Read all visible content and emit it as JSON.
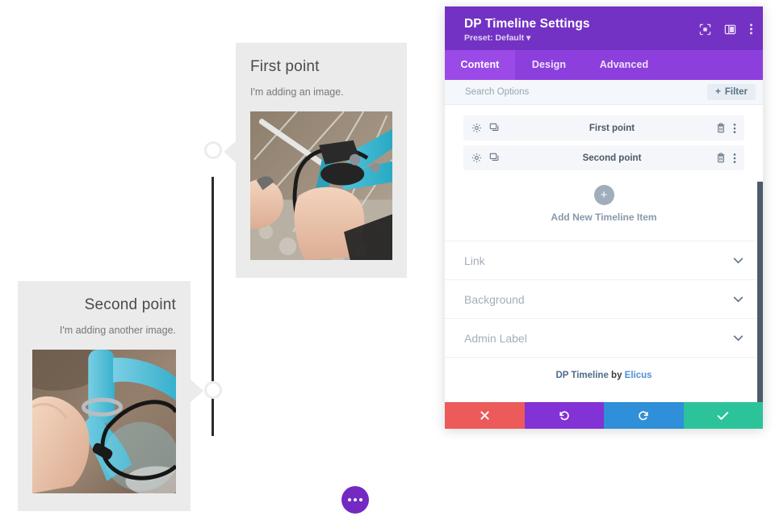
{
  "preview": {
    "items": [
      {
        "title": "First point",
        "description": "I'm adding an image.",
        "image_alt": "bicycle-repair-hands-photo"
      },
      {
        "title": "Second point",
        "description": "I'm adding another image.",
        "image_alt": "bicycle-frame-closeup-photo"
      }
    ],
    "fab_label": "more-options"
  },
  "modal": {
    "title": "DP Timeline Settings",
    "preset": "Preset: Default",
    "header_icons": [
      {
        "name": "focus-icon",
        "label": "Focus"
      },
      {
        "name": "layout-panel-icon",
        "label": "Layout"
      },
      {
        "name": "vertical-dots-icon",
        "label": "More"
      }
    ],
    "tabs": [
      {
        "label": "Content",
        "active": true
      },
      {
        "label": "Design",
        "active": false
      },
      {
        "label": "Advanced",
        "active": false
      }
    ],
    "search": {
      "placeholder": "Search Options",
      "value": ""
    },
    "filter_button": {
      "label": "Filter",
      "plus": "+"
    },
    "timeline_items": [
      {
        "name": "First point"
      },
      {
        "name": "Second point"
      }
    ],
    "row_icons": {
      "settings": "gear-icon",
      "duplicate": "duplicate-icon",
      "delete": "trash-icon",
      "more": "vertical-dots-icon"
    },
    "add_item": {
      "plus": "+",
      "label": "Add New Timeline Item"
    },
    "accordions": [
      {
        "label": "Link"
      },
      {
        "label": "Background"
      },
      {
        "label": "Admin Label"
      }
    ],
    "credit": {
      "product": "DP Timeline",
      "by": " by ",
      "author": "Elicus"
    },
    "footer_buttons": [
      {
        "name": "cancel-button",
        "icon": "close-icon",
        "color": "#ec5a5a"
      },
      {
        "name": "undo-button",
        "icon": "undo-icon",
        "color": "#8332d6"
      },
      {
        "name": "redo-button",
        "icon": "redo-icon",
        "color": "#2f8fd8"
      },
      {
        "name": "save-button",
        "icon": "check-icon",
        "color": "#2dc39a"
      }
    ]
  },
  "colors": {
    "header_purple": "#7332c4",
    "tab_bar_purple": "#8c3fdd",
    "tab_active_purple": "#9b4ae8",
    "card_gray": "#ebebeb",
    "rail_dark": "#2b2b2b",
    "fab_purple": "#7329c2",
    "scrollbar": "#4d5b6b"
  }
}
